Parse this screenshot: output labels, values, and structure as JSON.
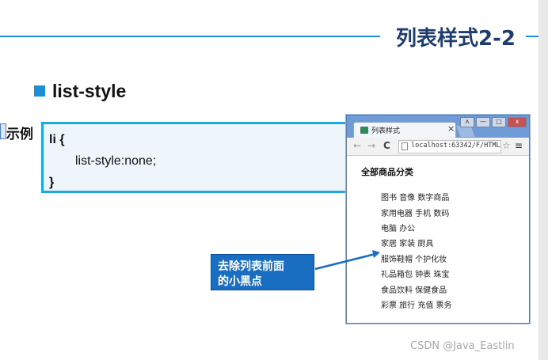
{
  "slide": {
    "title": "列表样式2-2",
    "heading": "list-style",
    "example_label": "示例",
    "code_lines": [
      "li {",
      "list-style:none;",
      "}"
    ]
  },
  "browser": {
    "tab_title": "列表样式",
    "tab_close": "×",
    "win_controls": [
      "ʌ",
      "—",
      "□",
      "x"
    ],
    "nav": {
      "back": "←",
      "forward": "→",
      "reload": "C"
    },
    "url": "localhost:63342/F/HTML",
    "star": "☆",
    "menu": "≡",
    "content_heading": "全部商品分类",
    "items": [
      "图书  音像  数字商品",
      "家用电器  手机  数码",
      "电脑  办公",
      "家居  家装  厨具",
      "服饰鞋帽  个护化妆",
      "礼品箱包  钟表  珠宝",
      "食品饮料  保健食品",
      "彩票  旅行  充值  票务"
    ]
  },
  "callout": {
    "lines": [
      "去除列表前面",
      "的小黑点"
    ]
  },
  "watermark": "CSDN @Java_Eastlin",
  "colors": {
    "accent_blue": "#1c8fd6",
    "title_navy": "#1f3c6e",
    "code_border": "#1fa8e0",
    "callout_bg": "#1a6ec2"
  }
}
